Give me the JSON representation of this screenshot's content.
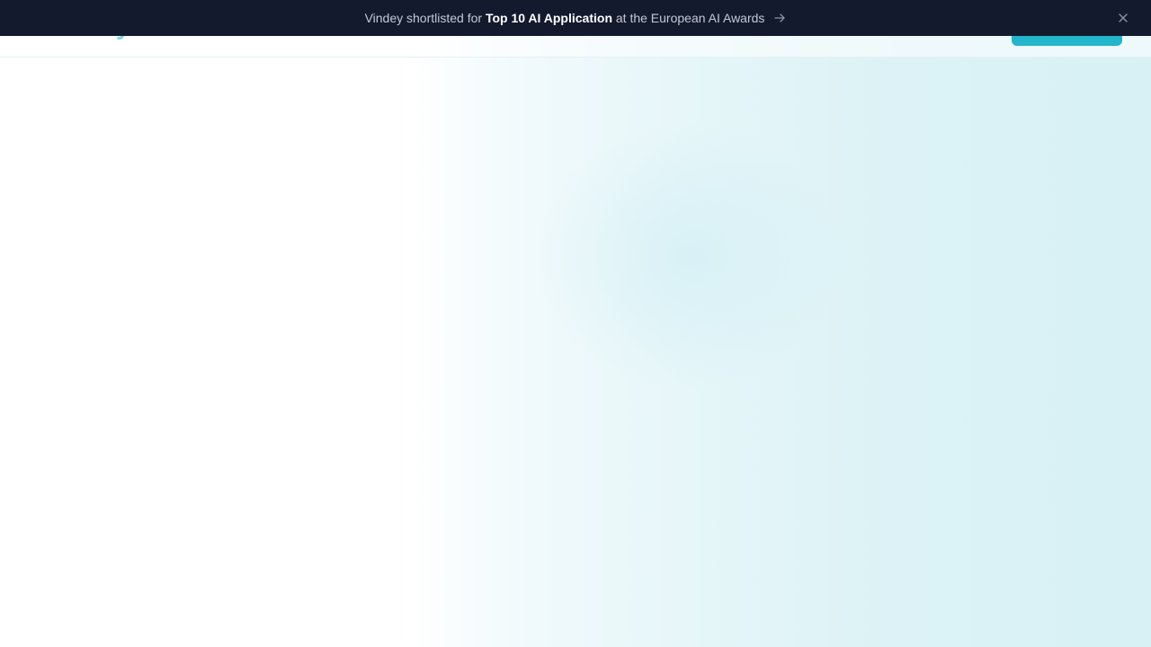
{
  "banner": {
    "text_before": "Vindey shortlisted for ",
    "highlight": "Top 10 AI Application",
    "text_after": " at the European AI Awards",
    "arrow_icon": "arrow-right-icon",
    "close_icon": "close-icon"
  },
  "header": {
    "logo_text": "Vindey"
  },
  "colors": {
    "banner_bg": "#131a2e",
    "accent": "#22b5cb",
    "logo": "#7fd9ea"
  }
}
